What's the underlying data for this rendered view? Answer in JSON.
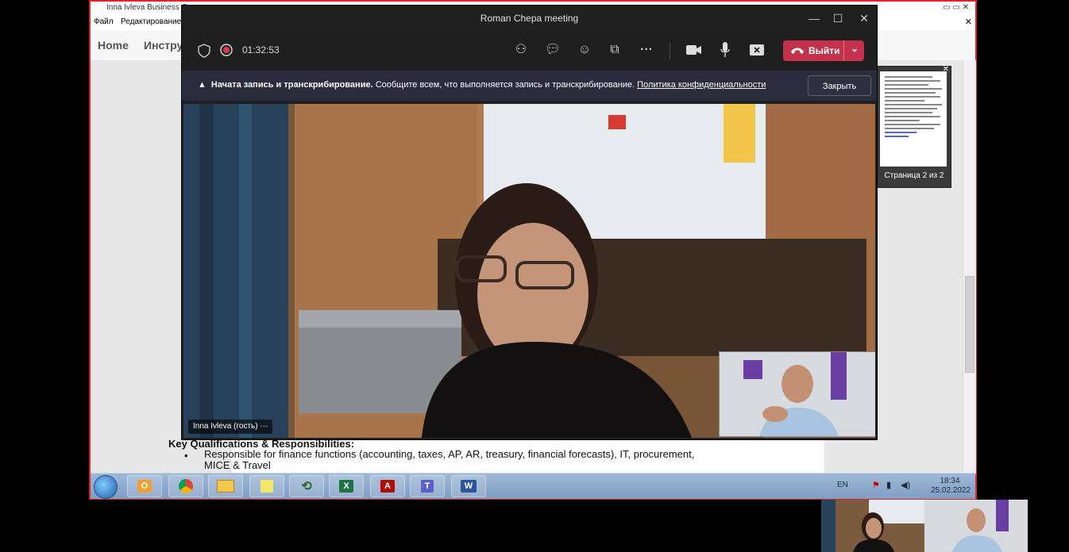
{
  "acrobat": {
    "title": "Inna Ivleva Business C",
    "menu": [
      "Файл",
      "Редактирование"
    ],
    "tools": [
      "Home",
      "Инстру"
    ]
  },
  "document": {
    "heading": "Key Qualifications & Responsibilities:",
    "bullet": "•",
    "bullet1": "Responsible for finance functions (accounting, taxes, AP, AR, treasury, financial forecasts), IT, procurement, MICE & Travel"
  },
  "teams": {
    "window_title": "Roman Chepa meeting",
    "timer": "01:32:53",
    "leave_label": "Выйти",
    "banner": {
      "bold": "Начата запись и транскрибирование.",
      "text": "Сообщите всем, что выполняется запись и транскрибирование.",
      "link": "Политика конфиденциальности",
      "close": "Закрыть"
    },
    "participant_name": "Inna Ivleva (гость)"
  },
  "thumbnail": {
    "caption": "Страница 2 из 2"
  },
  "taskbar": {
    "apps": [
      "outlook",
      "chrome",
      "explorer",
      "sticky-notes",
      "network",
      "excel",
      "acrobat",
      "teams",
      "word"
    ],
    "lang": "EN",
    "time": "18:34",
    "date": "25.02.2022"
  },
  "colors": {
    "leave_button": "#c4314b",
    "banner_bg": "#2b2b3d",
    "acrobat_border": "#e0262c"
  }
}
